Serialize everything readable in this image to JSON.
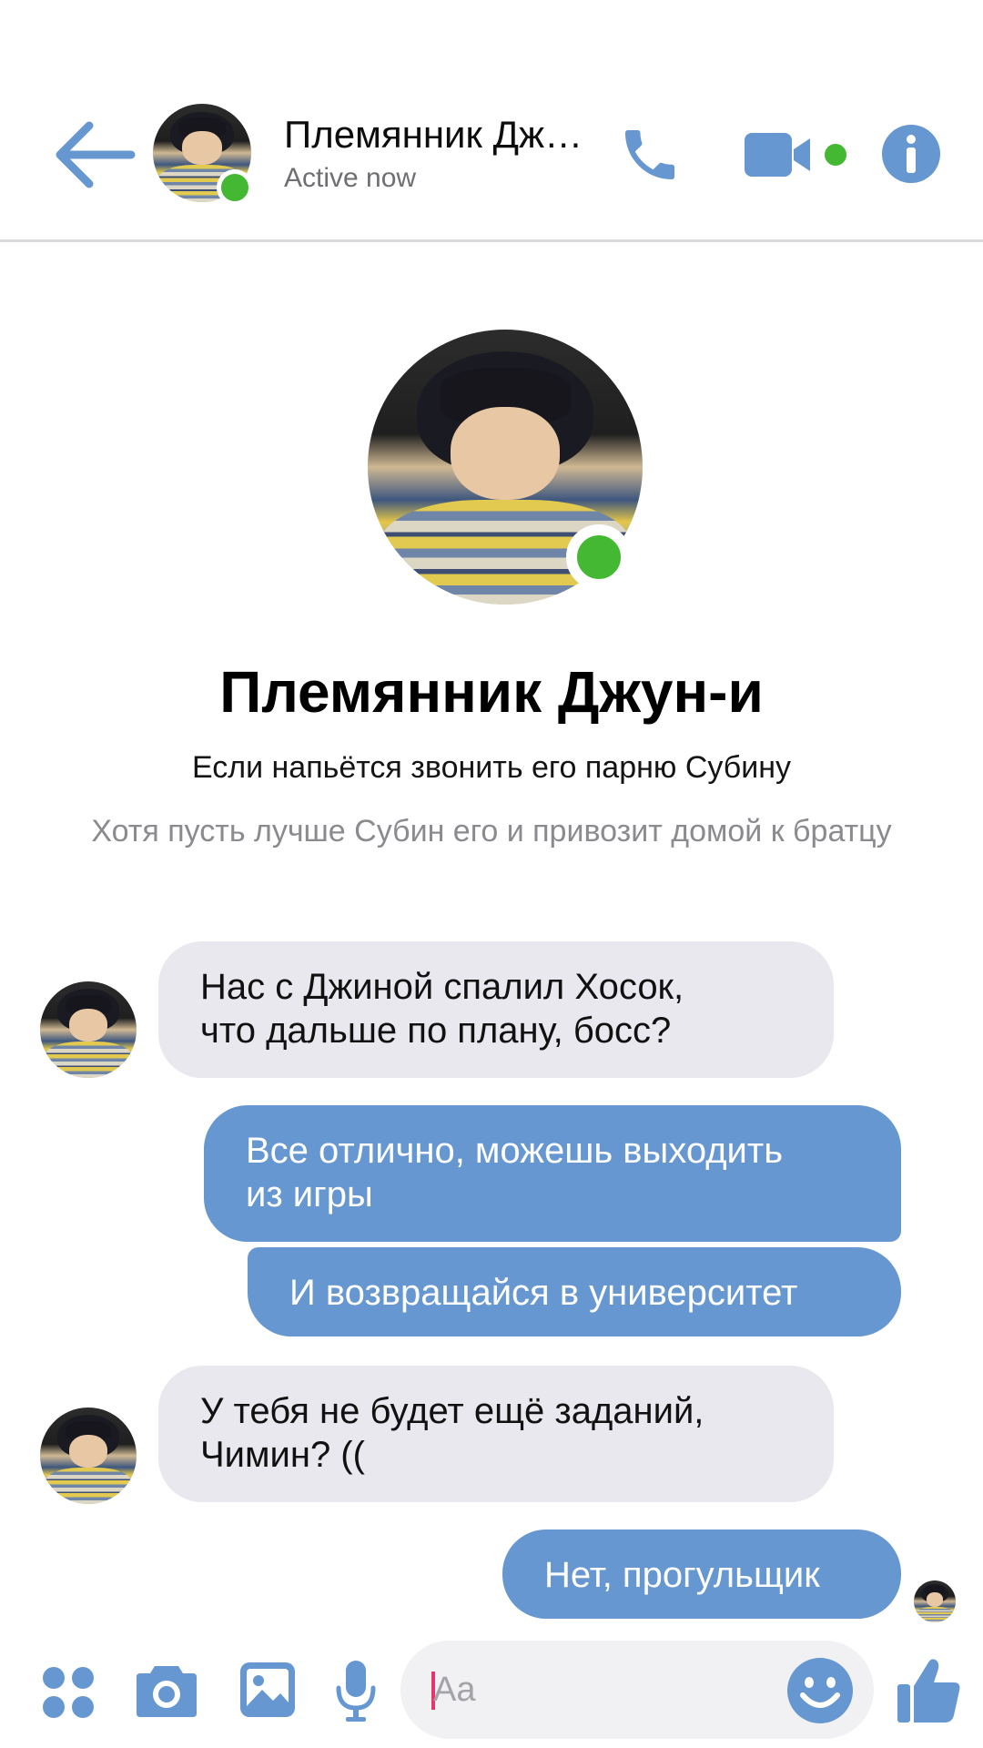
{
  "colors": {
    "accent": "#6697d1",
    "online": "#44b833",
    "incoming_bubble": "#e9e8ee",
    "caret": "#e8336b"
  },
  "header": {
    "contact_name": "Племянник Дж…",
    "status": "Active now",
    "icons": [
      "back-arrow-icon",
      "phone-icon",
      "video-camera-icon",
      "info-icon"
    ]
  },
  "profile": {
    "name": "Племянник Джун-и",
    "line1": "Если напьётся звонить его парню Субину",
    "line2": "Хотя пусть лучше Субин его и привозит домой к братцу"
  },
  "messages": [
    {
      "direction": "in",
      "text": "Нас с Джиной спалил Хосок,\nчто дальше по плану, босс?"
    },
    {
      "direction": "out",
      "text": "Все отлично, можешь выходить\nиз игры"
    },
    {
      "direction": "out",
      "text": "И возвращайся в университет"
    },
    {
      "direction": "in",
      "text": "У тебя не будет ещё заданий,\nЧимин? (("
    },
    {
      "direction": "out",
      "text": "Нет, прогульщик"
    }
  ],
  "composer": {
    "placeholder": "Aa",
    "icons": [
      "apps-icon",
      "camera-icon",
      "gallery-icon",
      "microphone-icon",
      "emoji-icon",
      "thumbs-up-icon"
    ]
  }
}
